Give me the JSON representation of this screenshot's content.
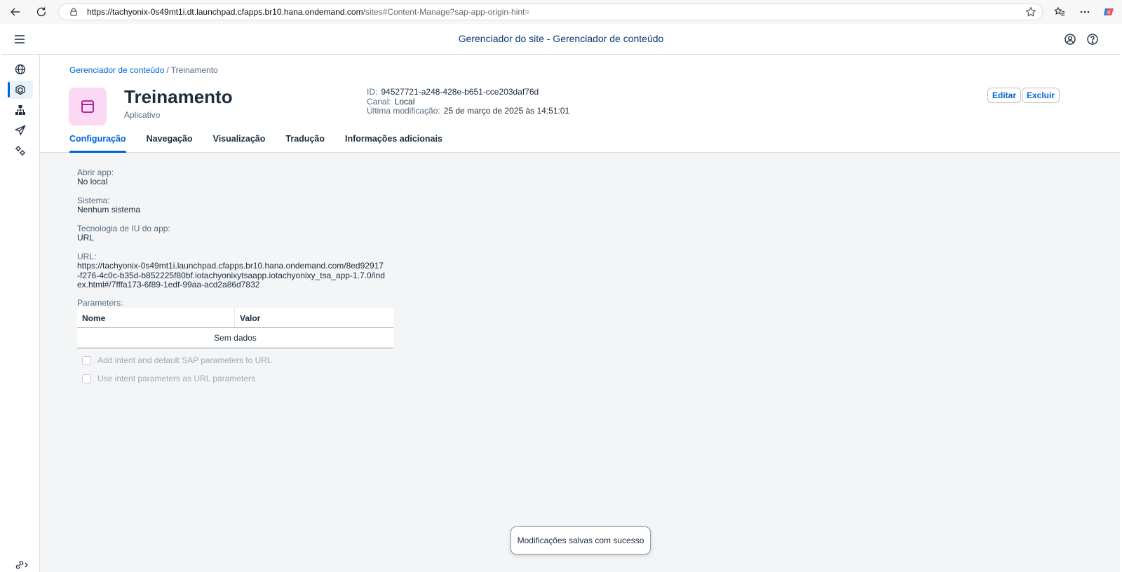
{
  "browser": {
    "url_host": "https://tachyonix-0s49mt1i.dt.launchpad.cfapps.br10.hana.ondemand.com",
    "url_path": "/sites#Content-Manage?sap-app-origin-hint="
  },
  "shell": {
    "title": "Gerenciador do site - Gerenciador de conteúdo"
  },
  "breadcrumb": {
    "parent": "Gerenciador de conteúdo",
    "separator": "/",
    "current": "Treinamento"
  },
  "object": {
    "title": "Treinamento",
    "subtitle": "Aplicativo",
    "id_label": "ID:",
    "id_value": "94527721-a248-428e-b651-cce203daf76d",
    "channel_label": "Canal:",
    "channel_value": "Local",
    "modified_label": "Última modificação:",
    "modified_value": "25 de março de 2025 às 14:51:01",
    "edit_label": "Editar",
    "delete_label": "Excluir"
  },
  "tabs": [
    {
      "label": "Configuração",
      "active": true
    },
    {
      "label": "Navegação",
      "active": false
    },
    {
      "label": "Visualização",
      "active": false
    },
    {
      "label": "Tradução",
      "active": false
    },
    {
      "label": "Informações adicionais",
      "active": false
    }
  ],
  "config": {
    "open_app_label": "Abrir app:",
    "open_app_value": "No local",
    "system_label": "Sistema:",
    "system_value": "Nenhum sistema",
    "ui_tech_label": "Tecnologia de IU do app:",
    "ui_tech_value": "URL",
    "url_label": "URL:",
    "url_value": "https://tachyonix-0s49mt1i.launchpad.cfapps.br10.hana.ondemand.com/8ed92917-f276-4c0c-b35d-b852225f80bf.iotachyonixytsaapp.iotachyonixy_tsa_app-1.7.0/index.html#/7fffa173-6f89-1edf-99aa-acd2a86d7832",
    "params_label": "Parameters:",
    "params_col_name": "Nome",
    "params_col_value": "Valor",
    "params_empty": "Sem dados",
    "chk_intent_label": "Add intent and default SAP parameters to URL",
    "chk_intent_params_label": "Use intent parameters as URL parameters"
  },
  "toast": {
    "message": "Modificações salvas com sucesso"
  },
  "colors": {
    "accent": "#0064d9",
    "app_icon_bg": "#fbd8f4",
    "app_icon_fg": "#a5118a"
  }
}
